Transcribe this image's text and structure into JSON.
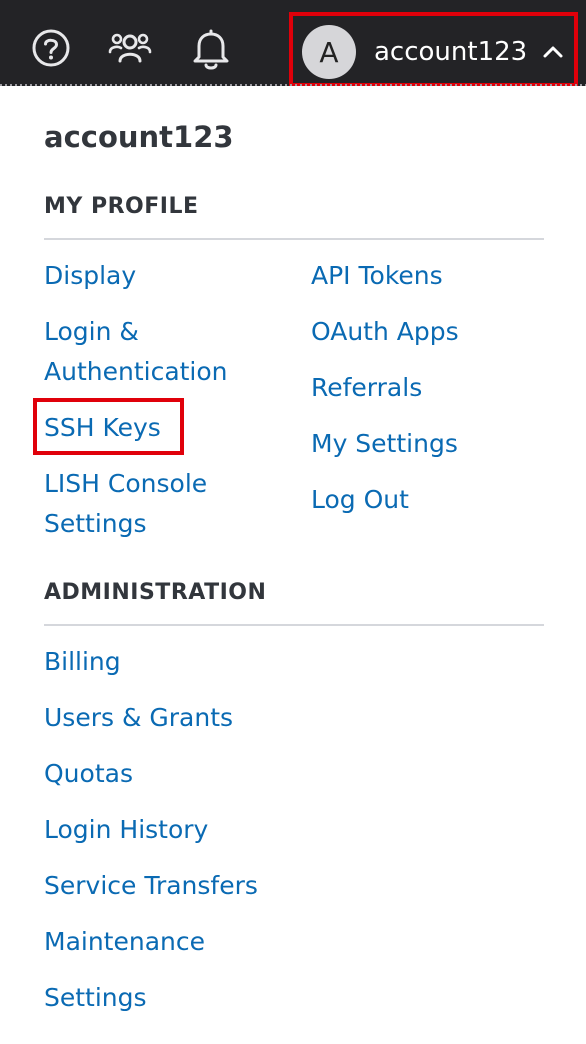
{
  "header": {
    "help_icon": "help-circle-icon",
    "community_icon": "users-icon",
    "notifications_icon": "bell-icon",
    "avatar_letter": "A",
    "account_name": "account123",
    "chevron_icon": "chevron-up-icon",
    "highlight_color": "#e0000a"
  },
  "menu": {
    "username": "account123",
    "profile_heading": "MY PROFILE",
    "profile_left": [
      "Display",
      "Login & Authentication",
      "SSH Keys",
      "LISH Console Settings"
    ],
    "profile_right": [
      "API Tokens",
      "OAuth Apps",
      "Referrals",
      "My Settings",
      "Log Out"
    ],
    "admin_heading": "ADMINISTRATION",
    "admin_links": [
      "Billing",
      "Users & Grants",
      "Quotas",
      "Login History",
      "Service Transfers",
      "Maintenance",
      "Settings"
    ],
    "link_color": "#0a6ab3"
  }
}
